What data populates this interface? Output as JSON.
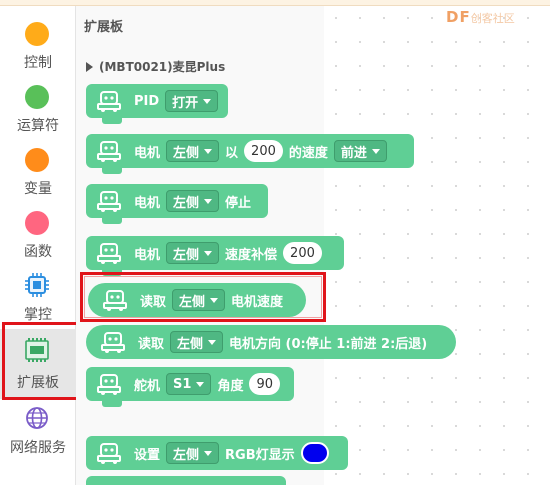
{
  "categories": [
    {
      "label": "控制",
      "color": "#ffab19"
    },
    {
      "label": "运算符",
      "color": "#59c059"
    },
    {
      "label": "变量",
      "color": "#ff8c1a"
    },
    {
      "label": "函数",
      "color": "#ff6680"
    },
    {
      "label": "掌控",
      "icon": "chip-icon"
    },
    {
      "label": "扩展板",
      "icon": "board-icon",
      "active": true
    },
    {
      "label": "网络服务",
      "icon": "globe-icon"
    }
  ],
  "flyout": {
    "title": "扩展板",
    "group_title": "(MBT0021)麦昆Plus",
    "blocks": [
      {
        "kind": "pid",
        "label": "PID",
        "dropdown": "打开"
      },
      {
        "kind": "motor-speed",
        "label": "电机",
        "side": "左侧",
        "mid": "以",
        "speed": "200",
        "suffix": "的速度",
        "direction": "前进"
      },
      {
        "kind": "motor-stop",
        "label": "电机",
        "side": "左侧",
        "suffix": "停止"
      },
      {
        "kind": "motor-comp",
        "label": "电机",
        "side": "左侧",
        "suffix": "速度补偿",
        "value": "200"
      },
      {
        "kind": "read-speed",
        "label": "读取",
        "side": "左侧",
        "suffix": "电机速度"
      },
      {
        "kind": "read-dir",
        "label": "读取",
        "side": "左侧",
        "suffix": "电机方向 (0:停止 1:前进 2:后退)"
      },
      {
        "kind": "servo",
        "label": "舵机",
        "port": "S1",
        "suffix": "角度",
        "value": "90"
      },
      {
        "kind": "rgb",
        "label": "设置",
        "side": "左侧",
        "suffix": "RGB灯显示",
        "color": "#0000ee"
      }
    ]
  },
  "logo": {
    "text": "DF",
    "ghost": "创客社区"
  },
  "colors": {
    "block": "#5fcf95",
    "highlight": "#e0141a"
  }
}
